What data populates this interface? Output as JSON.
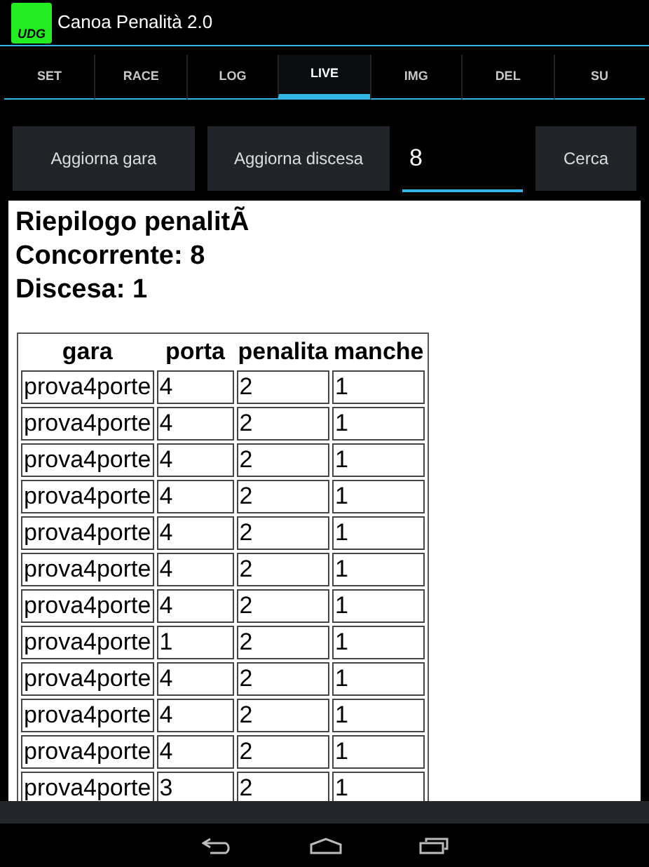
{
  "action_bar": {
    "logo_text": "UDG",
    "title": "Canoa Penalità 2.0"
  },
  "tabs": [
    {
      "label": "SET",
      "selected": false
    },
    {
      "label": "RACE",
      "selected": false
    },
    {
      "label": "LOG",
      "selected": false
    },
    {
      "label": "LIVE",
      "selected": true
    },
    {
      "label": "IMG",
      "selected": false
    },
    {
      "label": "DEL",
      "selected": false
    },
    {
      "label": "SU",
      "selected": false
    }
  ],
  "toolbar": {
    "buttons": [
      "Aggiorna gara",
      "Aggiorna discesa"
    ],
    "field_value": "8",
    "search_button": "Cerca"
  },
  "report": {
    "headings": [
      "Riepilogo penalitÃ",
      "Concorrente: 8",
      "Discesa: 1"
    ],
    "table": {
      "columns": [
        "gara",
        "porta",
        "penalita",
        "manche"
      ],
      "rows": [
        [
          "prova4porte",
          "4",
          "2",
          "1"
        ],
        [
          "prova4porte",
          "4",
          "2",
          "1"
        ],
        [
          "prova4porte",
          "4",
          "2",
          "1"
        ],
        [
          "prova4porte",
          "4",
          "2",
          "1"
        ],
        [
          "prova4porte",
          "4",
          "2",
          "1"
        ],
        [
          "prova4porte",
          "4",
          "2",
          "1"
        ],
        [
          "prova4porte",
          "4",
          "2",
          "1"
        ],
        [
          "prova4porte",
          "1",
          "2",
          "1"
        ],
        [
          "prova4porte",
          "4",
          "2",
          "1"
        ],
        [
          "prova4porte",
          "4",
          "2",
          "1"
        ],
        [
          "prova4porte",
          "4",
          "2",
          "1"
        ],
        [
          "prova4porte",
          "3",
          "2",
          "1"
        ]
      ]
    }
  }
}
